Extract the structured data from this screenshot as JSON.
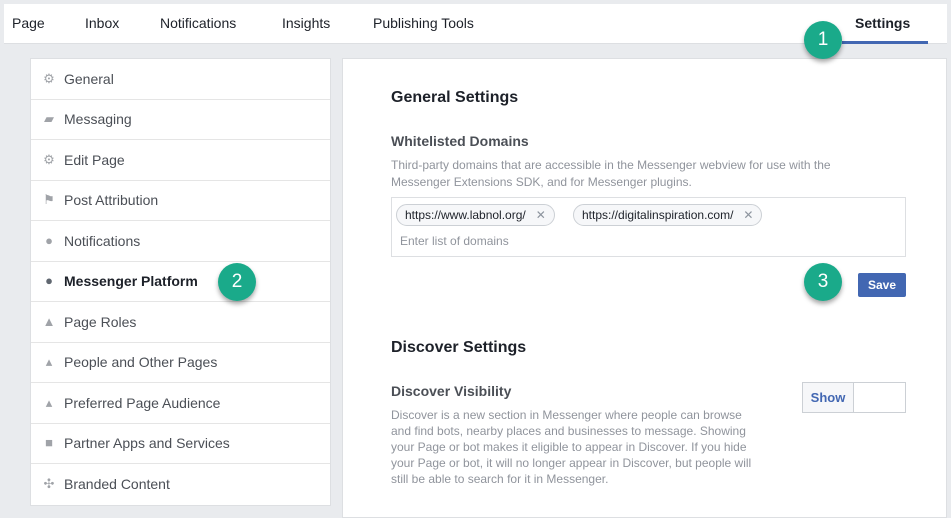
{
  "nav": {
    "tabs": [
      "Page",
      "Inbox",
      "Notifications",
      "Insights",
      "Publishing Tools"
    ],
    "active_tab": "Settings"
  },
  "badges": [
    "1",
    "2",
    "3"
  ],
  "sidebar": {
    "items": [
      {
        "label": "General",
        "icon": "gear-icon"
      },
      {
        "label": "Messaging",
        "icon": "chat-icon"
      },
      {
        "label": "Edit Page",
        "icon": "gear-icon"
      },
      {
        "label": "Post Attribution",
        "icon": "flag-icon"
      },
      {
        "label": "Notifications",
        "icon": "globe-icon"
      },
      {
        "label": "Messenger Platform",
        "icon": "messenger-icon"
      },
      {
        "label": "Page Roles",
        "icon": "person-icon"
      },
      {
        "label": "People and Other Pages",
        "icon": "person-star-icon"
      },
      {
        "label": "Preferred Page Audience",
        "icon": "person-star-icon"
      },
      {
        "label": "Partner Apps and Services",
        "icon": "box-icon"
      },
      {
        "label": "Branded Content",
        "icon": "handshake-icon"
      }
    ]
  },
  "general": {
    "title": "General Settings",
    "whitelist_label": "Whitelisted Domains",
    "whitelist_desc_1": "Third-party domains that are accessible in the Messenger webview for use with the",
    "whitelist_desc_2": "Messenger Extensions SDK, and for Messenger plugins.",
    "domains": [
      "https://www.labnol.org/",
      "https://digitalinspiration.com/"
    ],
    "placeholder": "Enter list of domains",
    "save": "Save"
  },
  "discover": {
    "title": "Discover Settings",
    "visibility_label": "Discover Visibility",
    "desc": [
      "Discover is a new section in Messenger where people can browse",
      "and find bots, nearby places and businesses to message. Showing",
      "your Page or bot makes it eligible to appear in Discover. If you hide",
      "your Page or bot, it will no longer appear in Discover, but people will",
      "still be able to search for it in Messenger."
    ],
    "toggle": "Show"
  },
  "colors": {
    "accent": "#4267b2",
    "badge": "#1aaa8a"
  }
}
